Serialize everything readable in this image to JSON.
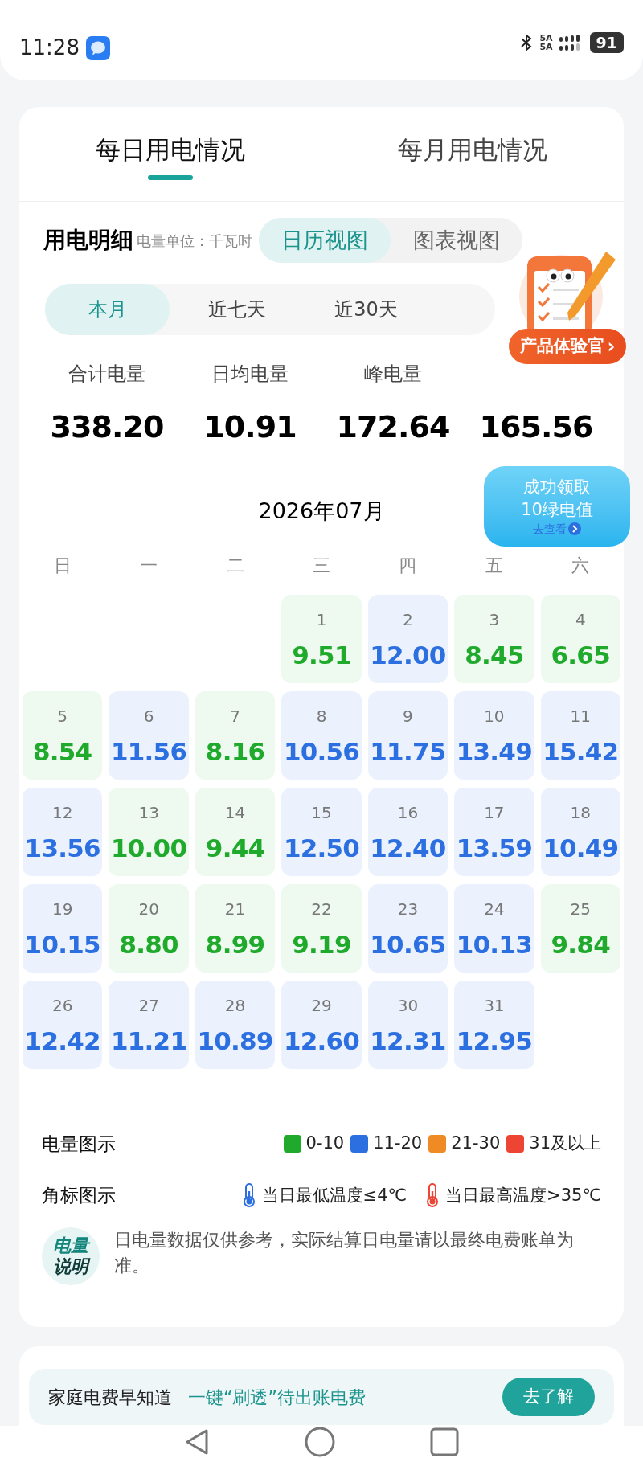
{
  "status_bar": {
    "time": "11:28",
    "network_1": "5A",
    "network_2": "5A",
    "battery": "91"
  },
  "main_tabs": [
    {
      "label": "每日用电情况",
      "selected": true
    },
    {
      "label": "每月用电情况",
      "selected": false
    }
  ],
  "detail": {
    "title": "用电明细",
    "unit": "电量单位：千瓦时",
    "views": [
      {
        "label": "日历视图",
        "selected": true
      },
      {
        "label": "图表视图",
        "selected": false
      }
    ]
  },
  "periods": [
    {
      "label": "本月",
      "selected": true
    },
    {
      "label": "近七天",
      "selected": false
    },
    {
      "label": "近30天",
      "selected": false
    }
  ],
  "stats": [
    {
      "label": "合计电量",
      "value": "338.20"
    },
    {
      "label": "日均电量",
      "value": "10.91"
    },
    {
      "label": "峰电量",
      "value": "172.64"
    },
    {
      "value": "165.56"
    }
  ],
  "mascot_badge": {
    "label": "产品体验官",
    "chevron": "›"
  },
  "reward_bubble": {
    "line_1": "成功领取",
    "line_2": "10绿电值",
    "link": "去查看"
  },
  "calendar": {
    "month": "2026年07月",
    "weekdays": [
      "日",
      "一",
      "二",
      "三",
      "四",
      "五",
      "六"
    ],
    "weeks": [
      [
        {
          "kind": "empty"
        },
        {
          "kind": "empty"
        },
        {
          "kind": "empty"
        },
        {
          "day": "1",
          "value": "9.51",
          "color": "#1faa2c"
        },
        {
          "day": "2",
          "value": "12.00",
          "color": "#2b6fe0"
        },
        {
          "day": "3",
          "value": "8.45",
          "color": "#1faa2c"
        },
        {
          "day": "4",
          "value": "6.65",
          "color": "#1faa2c"
        }
      ],
      [
        {
          "day": "5",
          "value": "8.54",
          "color": "#1faa2c"
        },
        {
          "day": "6",
          "value": "11.56",
          "color": "#2b6fe0"
        },
        {
          "day": "7",
          "value": "8.16",
          "color": "#1faa2c"
        },
        {
          "day": "8",
          "value": "10.56",
          "color": "#2b6fe0"
        },
        {
          "day": "9",
          "value": "11.75",
          "color": "#2b6fe0"
        },
        {
          "day": "10",
          "value": "13.49",
          "color": "#2b6fe0"
        },
        {
          "day": "11",
          "value": "15.42",
          "color": "#2b6fe0"
        }
      ],
      [
        {
          "day": "12",
          "value": "13.56",
          "color": "#2b6fe0"
        },
        {
          "day": "13",
          "value": "10.00",
          "color": "#1faa2c"
        },
        {
          "day": "14",
          "value": "9.44",
          "color": "#1faa2c"
        },
        {
          "day": "15",
          "value": "12.50",
          "color": "#2b6fe0"
        },
        {
          "day": "16",
          "value": "12.40",
          "color": "#2b6fe0"
        },
        {
          "day": "17",
          "value": "13.59",
          "color": "#2b6fe0"
        },
        {
          "day": "18",
          "value": "10.49",
          "color": "#2b6fe0"
        }
      ],
      [
        {
          "day": "19",
          "value": "10.15",
          "color": "#2b6fe0"
        },
        {
          "day": "20",
          "value": "8.80",
          "color": "#1faa2c"
        },
        {
          "day": "21",
          "value": "8.99",
          "color": "#1faa2c"
        },
        {
          "day": "22",
          "value": "9.19",
          "color": "#1faa2c"
        },
        {
          "day": "23",
          "value": "10.65",
          "color": "#2b6fe0"
        },
        {
          "day": "24",
          "value": "10.13",
          "color": "#2b6fe0"
        },
        {
          "day": "25",
          "value": "9.84",
          "color": "#1faa2c"
        }
      ],
      [
        {
          "day": "26",
          "value": "12.42",
          "color": "#2b6fe0"
        },
        {
          "day": "27",
          "value": "11.21",
          "color": "#2b6fe0"
        },
        {
          "day": "28",
          "value": "10.89",
          "color": "#2b6fe0"
        },
        {
          "day": "29",
          "value": "12.60",
          "color": "#2b6fe0"
        },
        {
          "day": "30",
          "value": "12.31",
          "color": "#2b6fe0"
        },
        {
          "day": "31",
          "value": "12.95",
          "color": "#2b6fe0"
        },
        {
          "kind": "empty"
        }
      ]
    ]
  },
  "legend": {
    "title": "电量图示",
    "items": [
      {
        "label": "0-10",
        "color": "#1faa2c"
      },
      {
        "label": "11-20",
        "color": "#2b6fe0"
      },
      {
        "label": "21-30",
        "color": "#f08a24"
      },
      {
        "label": "31及以上",
        "color": "#ee4433"
      }
    ]
  },
  "corner_legend": {
    "title": "角标图示",
    "items": [
      {
        "kind": "cold",
        "label": "当日最低温度≤4℃"
      },
      {
        "kind": "hot",
        "label": "当日最高温度>35℃"
      }
    ]
  },
  "note": {
    "badge_line_1": "电量",
    "badge_line_2": "说明",
    "text": "日电量数据仅供参考，实际结算日电量请以最终电费账单为准。"
  },
  "promo": {
    "title": "家庭电费早知道",
    "subtitle": "一键“刷透”待出账电费",
    "button": "去了解"
  }
}
